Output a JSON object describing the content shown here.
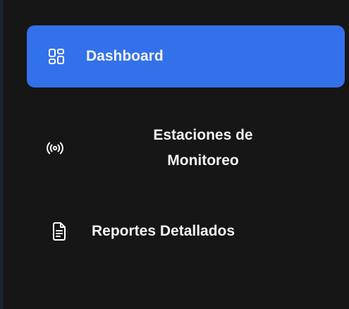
{
  "sidebar": {
    "items": [
      {
        "id": "dashboard",
        "label": "Dashboard",
        "icon": "layout-grid-icon",
        "active": true
      },
      {
        "id": "estaciones",
        "label": "Estaciones de Monitoreo",
        "icon": "radio-signal-icon",
        "active": false
      },
      {
        "id": "reportes",
        "label": "Reportes Detallados",
        "icon": "file-text-icon",
        "active": false
      }
    ]
  },
  "colors": {
    "background": "#161616",
    "active": "#3371ea",
    "text": "#f1f3f6"
  }
}
